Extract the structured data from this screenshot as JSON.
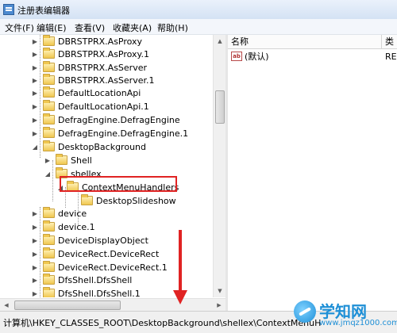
{
  "window": {
    "title": "注册表编辑器"
  },
  "menu": {
    "items": [
      "文件(F)",
      "编辑(E)",
      "查看(V)",
      "收藏夹(A)",
      "帮助(H)"
    ]
  },
  "tree": {
    "items": [
      {
        "label": "DBRSTPRX.AsProxy"
      },
      {
        "label": "DBRSTPRX.AsProxy.1"
      },
      {
        "label": "DBRSTPRX.AsServer"
      },
      {
        "label": "DBRSTPRX.AsServer.1"
      },
      {
        "label": "DefaultLocationApi"
      },
      {
        "label": "DefaultLocationApi.1"
      },
      {
        "label": "DefragEngine.DefragEngine"
      },
      {
        "label": "DefragEngine.DefragEngine.1"
      },
      {
        "label": "DesktopBackground"
      },
      {
        "label": "Shell"
      },
      {
        "label": "shellex"
      },
      {
        "label": "ContextMenuHandlers"
      },
      {
        "label": "DesktopSlideshow"
      },
      {
        "label": "device"
      },
      {
        "label": "device.1"
      },
      {
        "label": "DeviceDisplayObject"
      },
      {
        "label": "DeviceRect.DeviceRect"
      },
      {
        "label": "DeviceRect.DeviceRect.1"
      },
      {
        "label": "DfsShell.DfsShell"
      },
      {
        "label": "DfsShell.DfsShell.1"
      }
    ]
  },
  "values_pane": {
    "headers": {
      "name": "名称",
      "type": "类"
    },
    "rows": [
      {
        "icon": "ab",
        "name": "(默认)",
        "type": "RE"
      }
    ]
  },
  "statusbar": {
    "path": "计算机\\HKEY_CLASSES_ROOT\\DesktopBackground\\shellex\\ContextMenuH"
  },
  "watermark": {
    "brand": "学知网",
    "url": "www.jmqz1000.com"
  },
  "colors": {
    "highlight": "#e02323",
    "watermark": "#1e8fd6"
  }
}
